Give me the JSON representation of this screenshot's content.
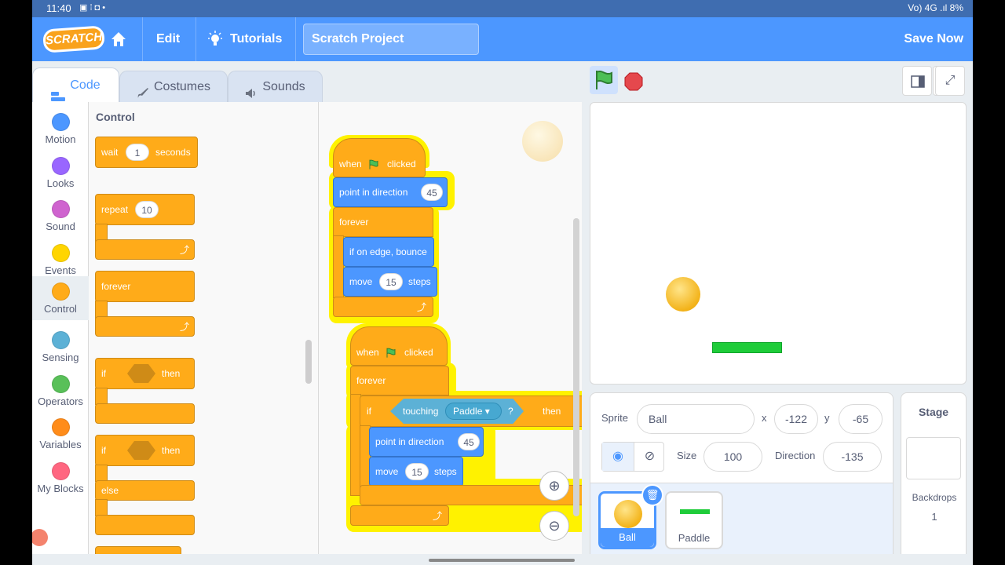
{
  "status_bar": {
    "time": "11:40",
    "indicators": "Vo) 4G .ıl 8%"
  },
  "menu": {
    "logo": "SCRATCH",
    "edit": "Edit",
    "tutorials": "Tutorials",
    "project_title": "Scratch Project",
    "save": "Save Now"
  },
  "tabs": {
    "code": "Code",
    "costumes": "Costumes",
    "sounds": "Sounds"
  },
  "categories": [
    {
      "label": "Motion",
      "color": "#4c97ff"
    },
    {
      "label": "Looks",
      "color": "#9966ff"
    },
    {
      "label": "Sound",
      "color": "#cf63cf"
    },
    {
      "label": "Events",
      "color": "#ffd500"
    },
    {
      "label": "Control",
      "color": "#ffab19"
    },
    {
      "label": "Sensing",
      "color": "#5cb1d6"
    },
    {
      "label": "Operators",
      "color": "#59c059"
    },
    {
      "label": "Variables",
      "color": "#ff8c1a"
    },
    {
      "label": "My Blocks",
      "color": "#ff6680"
    }
  ],
  "palette": {
    "heading": "Control",
    "wait": {
      "a": "wait",
      "value": "1",
      "b": "seconds"
    },
    "repeat": {
      "a": "repeat",
      "value": "10"
    },
    "forever": "forever",
    "if_then": {
      "a": "if",
      "b": "then"
    },
    "if_else": {
      "a": "if",
      "b": "then",
      "else": "else"
    }
  },
  "script1": {
    "when": "when",
    "clicked": "clicked",
    "point": "point in direction",
    "point_value": "45",
    "forever": "forever",
    "bounce": "if on edge, bounce",
    "move": "move",
    "move_value": "15",
    "steps": "steps"
  },
  "script2": {
    "when": "when",
    "clicked": "clicked",
    "forever": "forever",
    "if": "if",
    "touching": "touching",
    "target": "Paddle",
    "question": "?",
    "then": "then",
    "point": "point in direction",
    "point_value": "45",
    "move": "move",
    "move_value": "15",
    "steps": "steps"
  },
  "sprite": {
    "label": "Sprite",
    "name": "Ball",
    "x_label": "x",
    "x": "-122",
    "y_label": "y",
    "y": "-65",
    "size_label": "Size",
    "size": "100",
    "direction_label": "Direction",
    "direction": "-135"
  },
  "sprites": [
    {
      "name": "Ball"
    },
    {
      "name": "Paddle"
    }
  ],
  "stage_panel": {
    "title": "Stage",
    "backdrops_label": "Backdrops",
    "backdrops_count": "1"
  }
}
